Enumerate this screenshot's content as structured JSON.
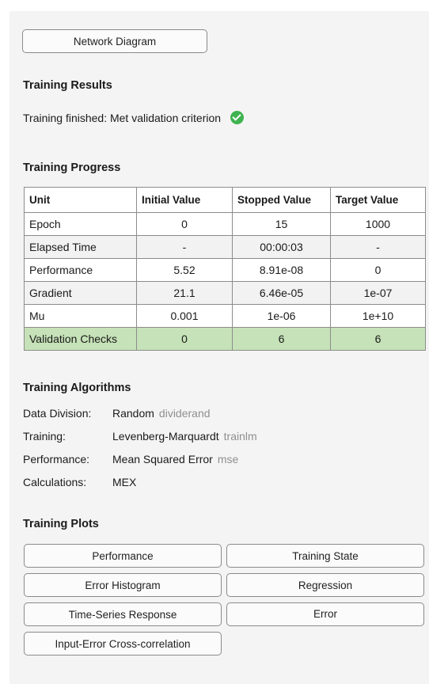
{
  "network_diagram_button": "Network Diagram",
  "results": {
    "title": "Training Results",
    "status_text": "Training finished: Met validation criterion",
    "status_icon": "check-circle-icon"
  },
  "progress": {
    "title": "Training Progress",
    "columns": [
      "Unit",
      "Initial Value",
      "Stopped Value",
      "Target Value"
    ],
    "rows": [
      {
        "unit": "Epoch",
        "initial": "0",
        "stopped": "15",
        "target": "1000"
      },
      {
        "unit": "Elapsed Time",
        "initial": "-",
        "stopped": "00:00:03",
        "target": "-"
      },
      {
        "unit": "Performance",
        "initial": "5.52",
        "stopped": "8.91e-08",
        "target": "0"
      },
      {
        "unit": "Gradient",
        "initial": "21.1",
        "stopped": "6.46e-05",
        "target": "1e-07"
      },
      {
        "unit": "Mu",
        "initial": "0.001",
        "stopped": "1e-06",
        "target": "1e+10"
      },
      {
        "unit": "Validation Checks",
        "initial": "0",
        "stopped": "6",
        "target": "6"
      }
    ],
    "highlight_color": "#c6e2b8"
  },
  "algorithms": {
    "title": "Training Algorithms",
    "items": [
      {
        "label": "Data Division:",
        "value": "Random",
        "fn": "dividerand"
      },
      {
        "label": "Training:",
        "value": "Levenberg-Marquardt",
        "fn": "trainlm"
      },
      {
        "label": "Performance:",
        "value": "Mean Squared Error",
        "fn": "mse"
      },
      {
        "label": "Calculations:",
        "value": "MEX",
        "fn": ""
      }
    ]
  },
  "plots": {
    "title": "Training Plots",
    "buttons": [
      "Performance",
      "Training State",
      "Error Histogram",
      "Regression",
      "Time-Series Response",
      "Error",
      "Input-Error Cross-correlation"
    ]
  }
}
